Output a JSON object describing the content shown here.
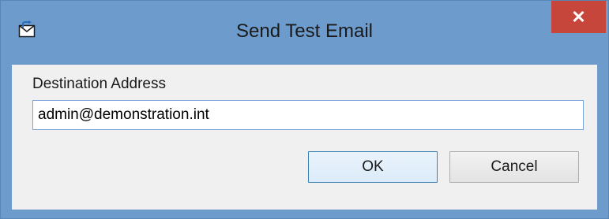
{
  "window": {
    "title": "Send Test Email",
    "close_label": "✕",
    "icon": "mail-send-icon"
  },
  "form": {
    "destination_label": "Destination Address",
    "destination_value": "admin@demonstration.int"
  },
  "buttons": {
    "ok_label": "OK",
    "cancel_label": "Cancel"
  },
  "colors": {
    "titlebar": "#6c9bcc",
    "close_button": "#c7463c",
    "client_background": "#f0f0f0",
    "input_border": "#7ca7d8",
    "ok_border": "#3c7fb1"
  }
}
